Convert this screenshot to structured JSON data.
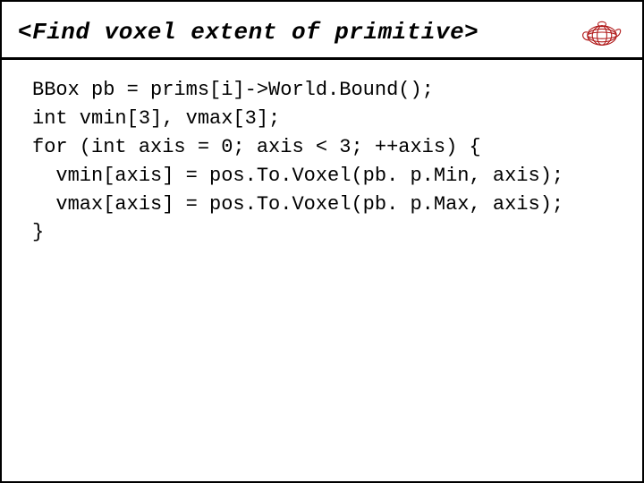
{
  "title": "<Find voxel extent of primitive>",
  "code": {
    "l1": "BBox pb = prims[i]->World.Bound();",
    "l2": "int vmin[3], vmax[3];",
    "l3": "for (int axis = 0; axis < 3; ++axis) {",
    "l4": "  vmin[axis] = pos.To.Voxel(pb. p.Min, axis);",
    "l5": "  vmax[axis] = pos.To.Voxel(pb. p.Max, axis);",
    "l6": "}"
  }
}
